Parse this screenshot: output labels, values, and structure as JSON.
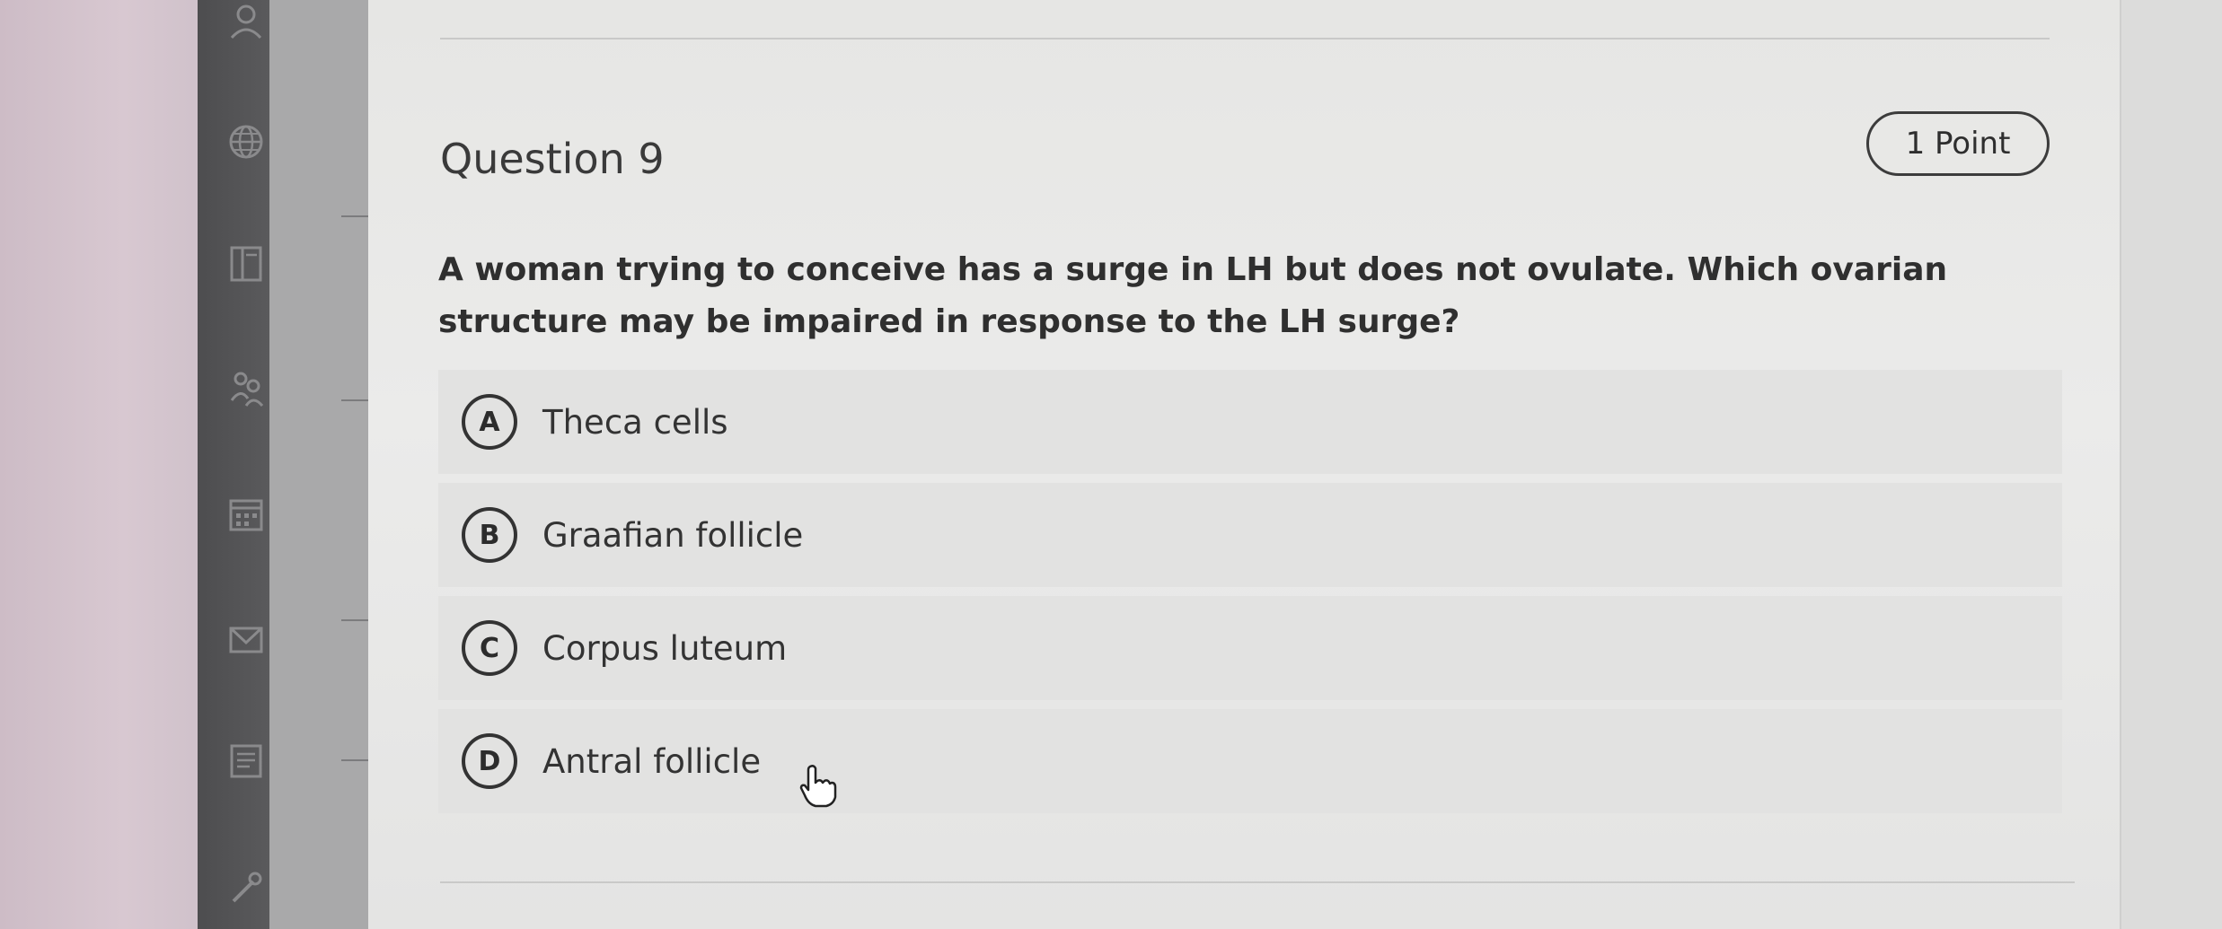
{
  "question": {
    "title": "Question 9",
    "points": "1 Point",
    "text": "A woman trying to conceive has a surge in LH but does not ovulate. Which ovarian structure may be impaired in response to the LH surge?",
    "options": [
      {
        "letter": "A",
        "label": "Theca cells"
      },
      {
        "letter": "B",
        "label": "Graafian follicle"
      },
      {
        "letter": "C",
        "label": "Corpus luteum"
      },
      {
        "letter": "D",
        "label": "Antral follicle"
      }
    ]
  },
  "sidebar": {
    "icons": [
      "user-icon",
      "globe-icon",
      "book-icon",
      "people-icon",
      "calendar-icon",
      "mail-icon",
      "document-icon",
      "tools-icon"
    ]
  },
  "colors": {
    "rail": "#555557",
    "card": "#e8e8e7",
    "option_bg": "#e2e2e1",
    "text": "#2f2f2f"
  }
}
